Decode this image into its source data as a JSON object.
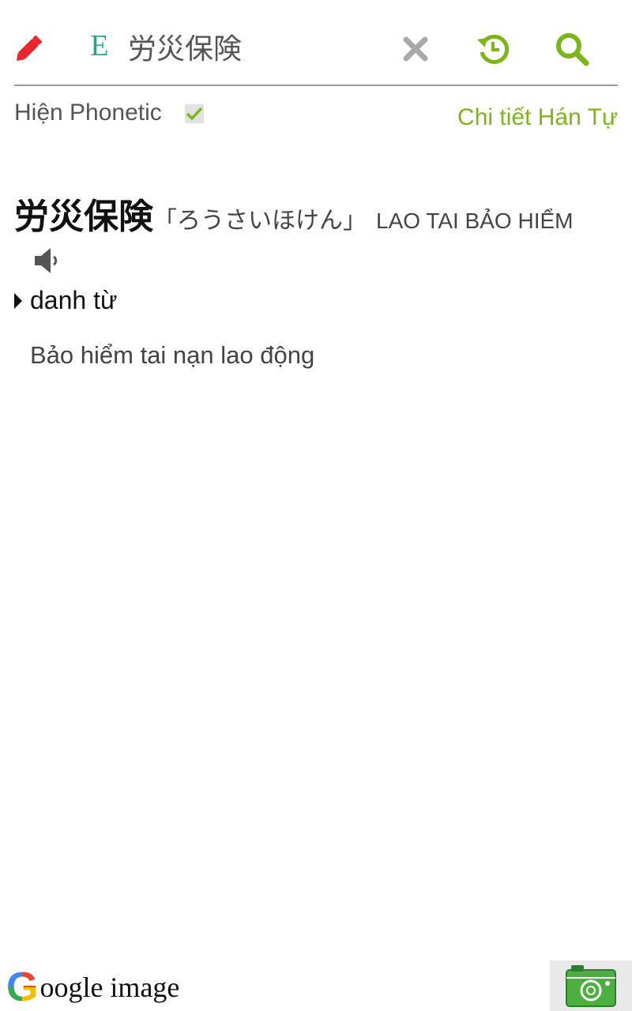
{
  "search": {
    "lang_label": "E",
    "query": "労災保険"
  },
  "options": {
    "phonetic_label": "Hiện Phonetic",
    "phonetic_checked": true,
    "kanji_detail_link": "Chi tiết Hán Tự"
  },
  "entry": {
    "word": "労災保険",
    "reading": "「ろうさいほけん」",
    "hanviet": "LAO TAI BẢO HIỂM",
    "part_of_speech": "danh từ",
    "meaning": "Bảo hiểm tai nạn lao động"
  },
  "footer": {
    "google_g": "G",
    "google_text": "oogle image"
  },
  "colors": {
    "accent_green": "#7cb518",
    "lang_teal": "#1fa88a",
    "pencil_red": "#e8262b"
  },
  "icons": [
    "pencil-icon",
    "clear-icon",
    "history-icon",
    "search-icon",
    "check-icon",
    "speaker-icon",
    "camera-icon",
    "triangle-icon"
  ]
}
